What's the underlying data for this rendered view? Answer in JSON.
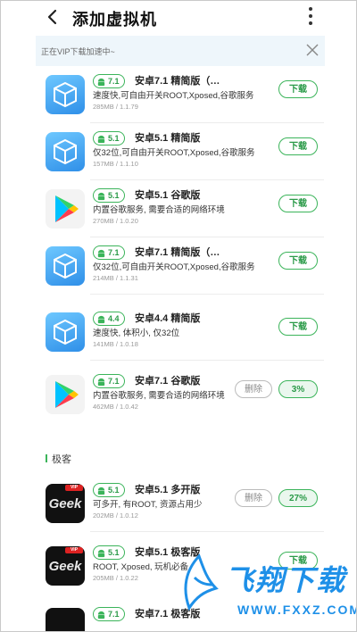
{
  "header": {
    "title": "添加虚拟机"
  },
  "banner": {
    "text": "正在VIP下载加速中~"
  },
  "items": [
    {
      "version": "7.1",
      "name": "安卓7.1 精简版（…",
      "desc": "速度快,可自由开关ROOT,Xposed,谷歌服务",
      "meta": "285MB / 1.1.79",
      "icon": "vm",
      "button": "下载"
    },
    {
      "version": "5.1",
      "name": "安卓5.1 精简版",
      "desc": "仅32位,可自由开关ROOT,Xposed,谷歌服务",
      "meta": "157MB / 1.1.10",
      "icon": "vm",
      "button": "下载"
    },
    {
      "version": "5.1",
      "name": "安卓5.1 谷歌版",
      "desc": "内置谷歌服务, 需要合适的网络环境",
      "meta": "270MB / 1.0.20",
      "icon": "play",
      "button": "下载"
    },
    {
      "version": "7.1",
      "name": "安卓7.1 精简版（…",
      "desc": "仅32位,可自由开关ROOT,Xposed,谷歌服务",
      "meta": "214MB / 1.1.31",
      "icon": "vm",
      "button": "下载"
    },
    {
      "version": "4.4",
      "name": "安卓4.4 精简版",
      "desc": "速度快, 体积小, 仅32位",
      "meta": "141MB / 1.0.18",
      "icon": "vm",
      "button": "下载"
    },
    {
      "version": "7.1",
      "name": "安卓7.1 谷歌版",
      "desc": "内置谷歌服务, 需要合适的网络环境",
      "meta": "462MB / 1.0.42",
      "icon": "play",
      "delete": "删除",
      "progress": "3%"
    }
  ],
  "section": {
    "title": "极客"
  },
  "geek_items": [
    {
      "version": "5.1",
      "name": "安卓5.1 多开版",
      "desc": "可多开, 有ROOT, 资源占用少",
      "meta": "202MB / 1.0.12",
      "icon_label": "Geek",
      "icon_tag": "VIP",
      "delete": "删除",
      "progress": "27%"
    },
    {
      "version": "5.1",
      "name": "安卓5.1 极客版",
      "desc": "ROOT, Xposed, 玩机必备",
      "meta": "205MB / 1.0.22",
      "icon_label": "Geek",
      "icon_tag": "VIP",
      "button": "下载"
    },
    {
      "version": "7.1",
      "name": "安卓7.1 极客版"
    }
  ],
  "watermark": {
    "text": "飞翔下载",
    "url": "WWW.FXXZ.COM"
  },
  "colors": {
    "accent": "#3bb45a",
    "banner_bg": "#eef6fb",
    "watermark": "#1e90e8"
  }
}
